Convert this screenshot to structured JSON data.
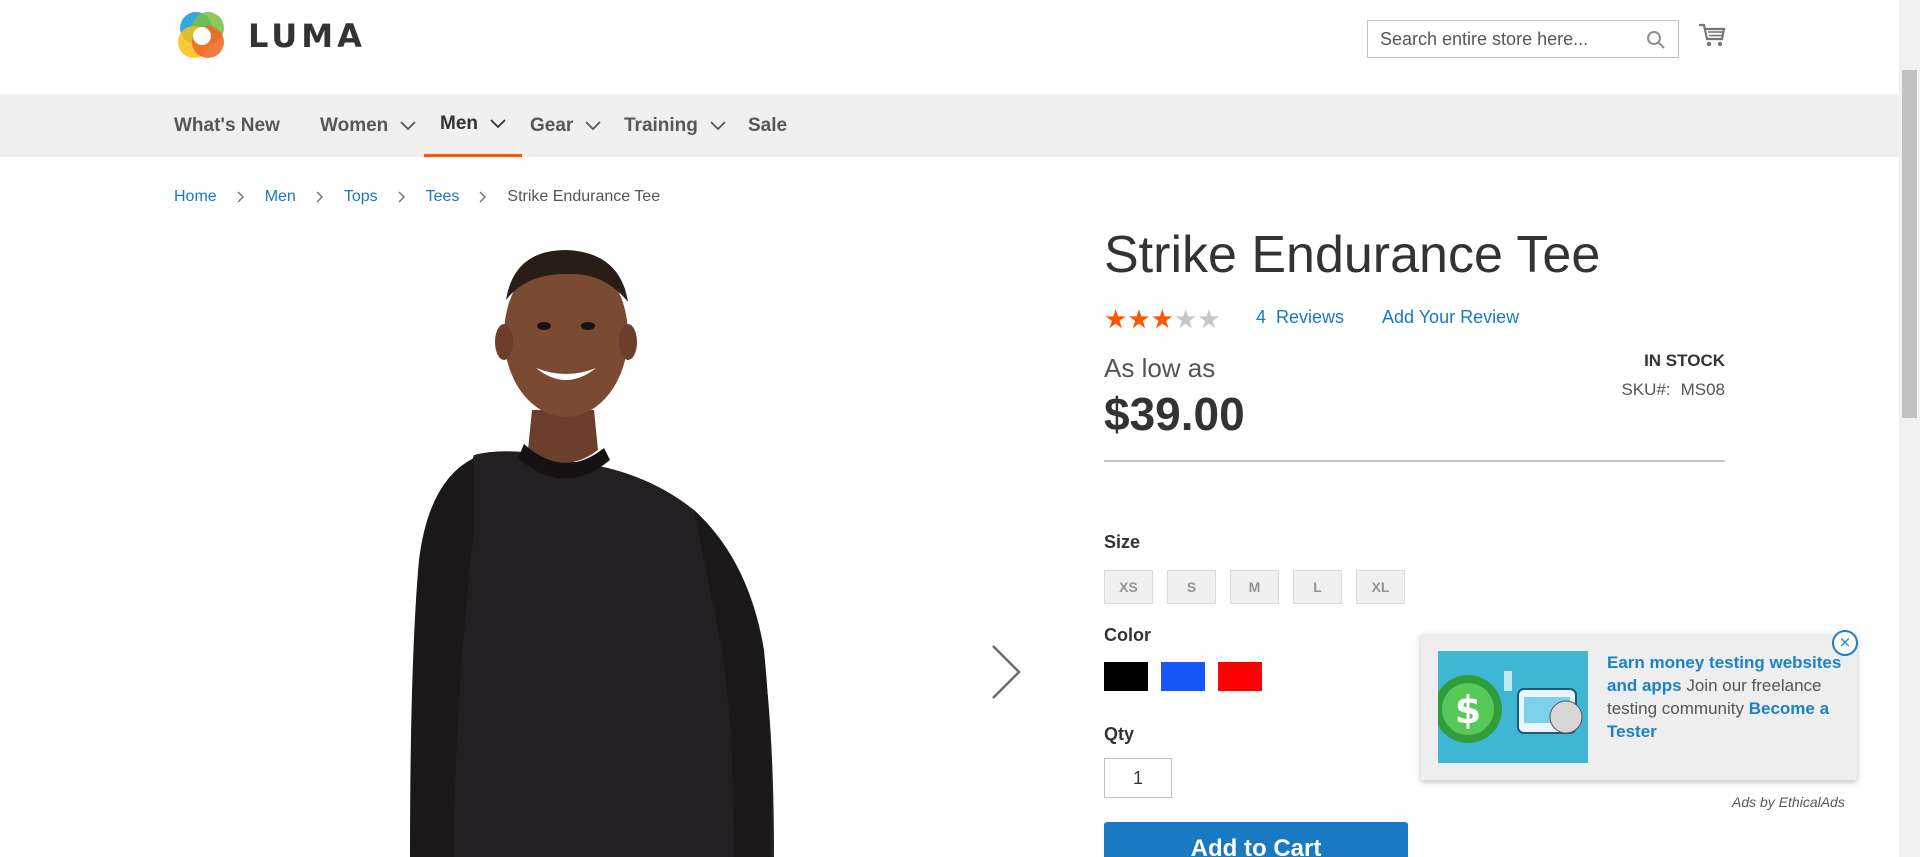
{
  "header": {
    "logo_text": "LUMA",
    "search_placeholder": "Search entire store here...",
    "icons": [
      "luma-logo-icon",
      "search-icon",
      "cart-icon"
    ]
  },
  "nav": {
    "items": [
      {
        "label": "What's New",
        "has_dropdown": false,
        "active": false
      },
      {
        "label": "Women",
        "has_dropdown": true,
        "active": false
      },
      {
        "label": "Men",
        "has_dropdown": true,
        "active": true
      },
      {
        "label": "Gear",
        "has_dropdown": true,
        "active": false
      },
      {
        "label": "Training",
        "has_dropdown": true,
        "active": false
      },
      {
        "label": "Sale",
        "has_dropdown": false,
        "active": false
      }
    ]
  },
  "breadcrumb": {
    "items": [
      "Home",
      "Men",
      "Tops",
      "Tees"
    ],
    "current": "Strike Endurance Tee"
  },
  "product": {
    "title": "Strike Endurance Tee",
    "rating_stars": 3,
    "rating_max": 5,
    "reviews_count": "4",
    "reviews_label": "Reviews",
    "add_review_label": "Add Your Review",
    "as_low_as": "As low as",
    "price": "$39.00",
    "stock": "IN STOCK",
    "sku_label": "SKU#:",
    "sku_value": "MS08",
    "size_label": "Size",
    "sizes": [
      "XS",
      "S",
      "M",
      "L",
      "XL"
    ],
    "color_label": "Color",
    "colors": [
      "#000000",
      "#1857f7",
      "#ff0000"
    ],
    "qty_label": "Qty",
    "qty_value": "1",
    "add_to_cart": "Add to Cart"
  },
  "ad": {
    "headline": "Earn money testing websites and apps",
    "body": " Join our freelance testing community ",
    "cta": "Become a Tester",
    "by": "Ads by EthicalAds",
    "close": "×"
  },
  "colors": {
    "accent": "#ff5501",
    "link": "#1979c3",
    "nav_bg": "#f0f0f0",
    "star_filled": "#ff5501",
    "star_empty": "#c7c7c7"
  }
}
